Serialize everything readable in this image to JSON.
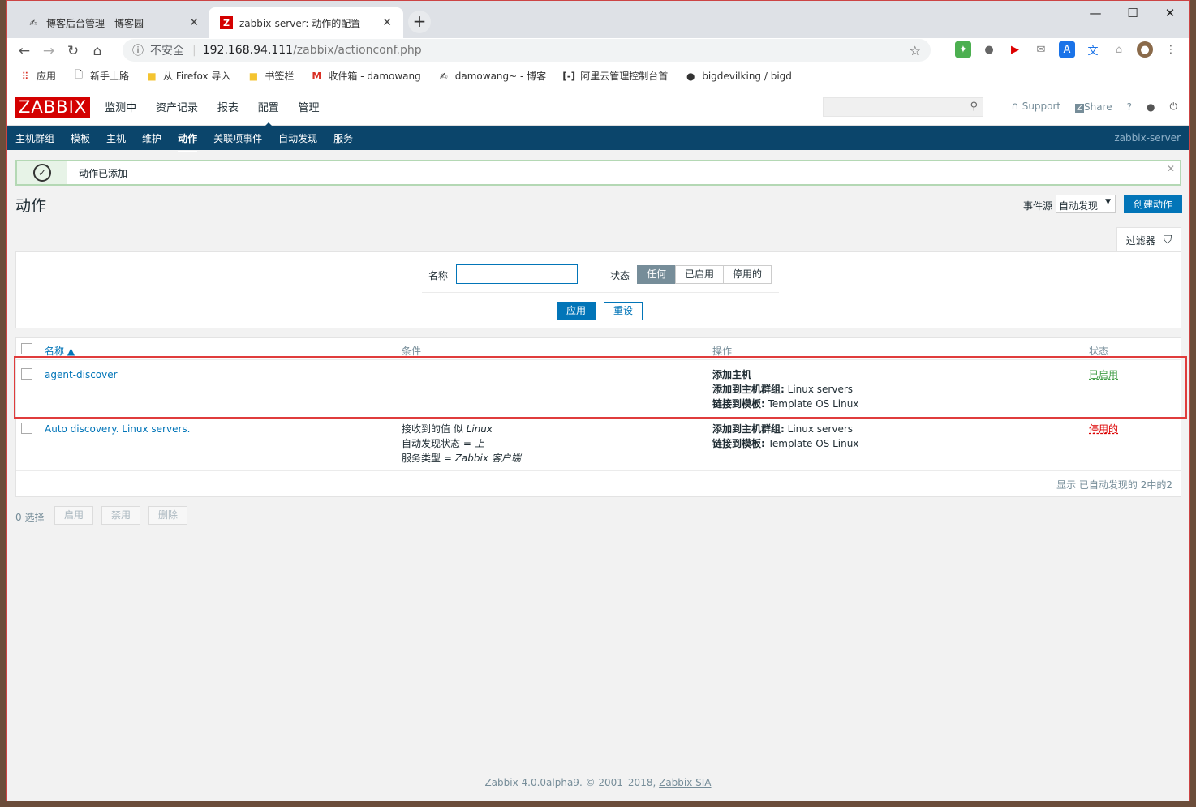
{
  "browser": {
    "tabs": [
      {
        "title": "博客后台管理 - 博客园",
        "active": false
      },
      {
        "title": "zabbix-server: 动作的配置",
        "active": true
      }
    ],
    "address": {
      "security_label": "不安全",
      "host": "192.168.94.111",
      "path": "/zabbix/actionconf.php"
    },
    "bookmarks": [
      {
        "label": "应用",
        "icon": "apps-grid-icon"
      },
      {
        "label": "新手上路",
        "icon": "page-icon"
      },
      {
        "label": "从 Firefox 导入",
        "icon": "folder-icon"
      },
      {
        "label": "书签栏",
        "icon": "folder-icon"
      },
      {
        "label": "收件箱 - damowang",
        "icon": "gmail-icon"
      },
      {
        "label": "damowang~ - 博客",
        "icon": "cnblogs-icon"
      },
      {
        "label": "阿里云管理控制台首",
        "icon": "aliyun-icon"
      },
      {
        "label": "bigdevilking / bigd",
        "icon": "github-icon"
      }
    ]
  },
  "zabbix": {
    "logo": "ZABBIX",
    "top_menu": [
      "监测中",
      "资产记录",
      "报表",
      "配置",
      "管理"
    ],
    "top_menu_selected": "配置",
    "support_label": "Support",
    "share_label": "Share",
    "help_label": "?",
    "sub_menu": [
      "主机群组",
      "模板",
      "主机",
      "维护",
      "动作",
      "关联项事件",
      "自动发现",
      "服务"
    ],
    "sub_menu_selected": "动作",
    "server_name": "zabbix-server",
    "message": "动作已添加",
    "page_title": "动作",
    "event_source_label": "事件源",
    "event_source_value": "自动发现",
    "create_button": "创建动作",
    "filter": {
      "tab_label": "过滤器",
      "name_label": "名称",
      "name_value": "",
      "status_label": "状态",
      "status_options": [
        "任何",
        "已启用",
        "停用的"
      ],
      "status_selected": "任何",
      "apply": "应用",
      "reset": "重设"
    },
    "table": {
      "headers": {
        "name": "名称 ▲",
        "conditions": "条件",
        "operations": "操作",
        "status": "状态"
      },
      "rows": [
        {
          "name": "agent-discover",
          "conditions": [],
          "operations": [
            {
              "bold": "添加主机",
              "rest": ""
            },
            {
              "bold": "添加到主机群组:",
              "rest": " Linux servers"
            },
            {
              "bold": "链接到模板:",
              "rest": " Template OS Linux"
            }
          ],
          "status": "已启用"
        },
        {
          "name": "Auto discovery. Linux servers.",
          "conditions": [
            {
              "text": "接收到的值 似 ",
              "italic": "Linux"
            },
            {
              "text": "自动发现状态 = ",
              "italic": "上"
            },
            {
              "text": "服务类型 = ",
              "italic": "Zabbix 客户端"
            }
          ],
          "operations": [
            {
              "bold": "添加到主机群组:",
              "rest": " Linux servers"
            },
            {
              "bold": "链接到模板:",
              "rest": " Template OS Linux"
            }
          ],
          "status": "停用的"
        }
      ],
      "counter": "显示 已自动发现的 2中的2"
    },
    "selection": {
      "count_label": "0 选择",
      "buttons": [
        "启用",
        "禁用",
        "删除"
      ]
    },
    "footer": {
      "text": "Zabbix 4.0.0alpha9. © 2001–2018, ",
      "link": "Zabbix SIA"
    }
  },
  "colors": {
    "accent": "#0275b8",
    "header_bg": "#0b456b",
    "logo": "#d40000",
    "enabled": "#429e47",
    "disabled": "#dc0000"
  }
}
